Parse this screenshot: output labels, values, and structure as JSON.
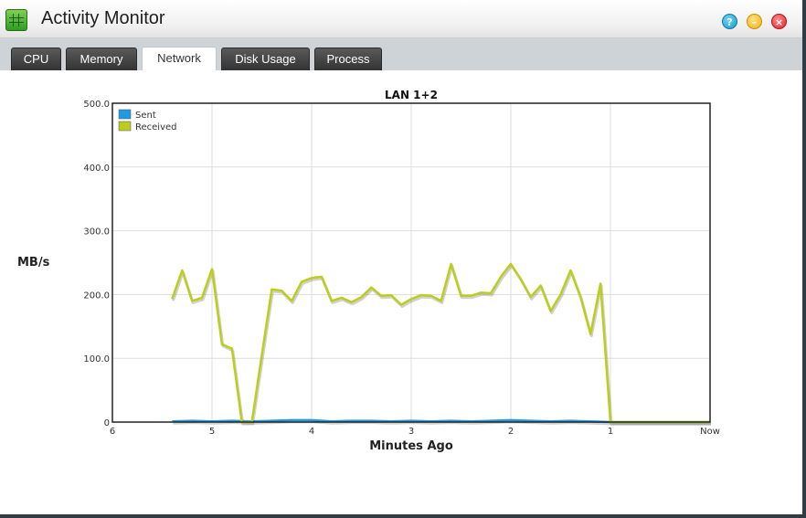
{
  "window": {
    "title": "Activity Monitor"
  },
  "tabs": [
    {
      "label": "CPU",
      "active": false
    },
    {
      "label": "Memory",
      "active": false
    },
    {
      "label": "Network",
      "active": true
    },
    {
      "label": "Disk Usage",
      "active": false
    },
    {
      "label": "Process",
      "active": false
    }
  ],
  "colors": {
    "sent": "#1e9be0",
    "received": "#bccd1c"
  },
  "chart_data": {
    "type": "line",
    "title": "LAN 1+2",
    "xlabel": "Minutes Ago",
    "ylabel": "MB/s",
    "xlim": [
      6,
      0
    ],
    "ylim": [
      0,
      500
    ],
    "xticks": [
      {
        "value": 6,
        "label": "6"
      },
      {
        "value": 5,
        "label": "5"
      },
      {
        "value": 4,
        "label": "4"
      },
      {
        "value": 3,
        "label": "3"
      },
      {
        "value": 2,
        "label": "2"
      },
      {
        "value": 1,
        "label": "1"
      },
      {
        "value": 0,
        "label": "Now"
      }
    ],
    "yticks": [
      {
        "value": 0,
        "label": "0"
      },
      {
        "value": 100,
        "label": "100.0"
      },
      {
        "value": 200,
        "label": "200.0"
      },
      {
        "value": 300,
        "label": "300.0"
      },
      {
        "value": 400,
        "label": "400.0"
      },
      {
        "value": 500,
        "label": "500.0"
      }
    ],
    "grid": true,
    "legend_position": "top-left",
    "series": [
      {
        "name": "Sent",
        "color": "#1e9be0",
        "x": [
          5.4,
          5.2,
          5.0,
          4.8,
          4.6,
          4.4,
          4.2,
          4.0,
          3.8,
          3.6,
          3.4,
          3.2,
          3.0,
          2.8,
          2.6,
          2.4,
          2.2,
          2.0,
          1.8,
          1.6,
          1.4,
          1.2,
          1.0,
          0.8,
          0.6,
          0.4,
          0.2,
          0.0
        ],
        "y": [
          1,
          2,
          1,
          2,
          1,
          2,
          3,
          3,
          1,
          2,
          2,
          1,
          2,
          1,
          2,
          1,
          2,
          3,
          2,
          1,
          2,
          1,
          0,
          0,
          0,
          0,
          0,
          0
        ]
      },
      {
        "name": "Received",
        "color": "#bccd1c",
        "x": [
          5.4,
          5.3,
          5.2,
          5.1,
          5.0,
          4.9,
          4.8,
          4.7,
          4.6,
          4.5,
          4.4,
          4.3,
          4.2,
          4.1,
          4.0,
          3.9,
          3.8,
          3.7,
          3.6,
          3.5,
          3.4,
          3.3,
          3.2,
          3.1,
          3.0,
          2.9,
          2.8,
          2.7,
          2.6,
          2.5,
          2.4,
          2.3,
          2.2,
          2.1,
          2.0,
          1.9,
          1.8,
          1.7,
          1.6,
          1.5,
          1.4,
          1.3,
          1.2,
          1.1,
          1.0,
          0.8,
          0.6,
          0.4,
          0.2,
          0.0
        ],
        "y": [
          193,
          238,
          190,
          195,
          240,
          122,
          115,
          0,
          0,
          105,
          208,
          206,
          190,
          220,
          226,
          228,
          190,
          195,
          188,
          196,
          211,
          198,
          199,
          184,
          193,
          199,
          198,
          190,
          248,
          198,
          198,
          203,
          202,
          228,
          248,
          224,
          196,
          214,
          174,
          200,
          238,
          196,
          138,
          217,
          0,
          0,
          0,
          0,
          0,
          0
        ]
      }
    ]
  }
}
